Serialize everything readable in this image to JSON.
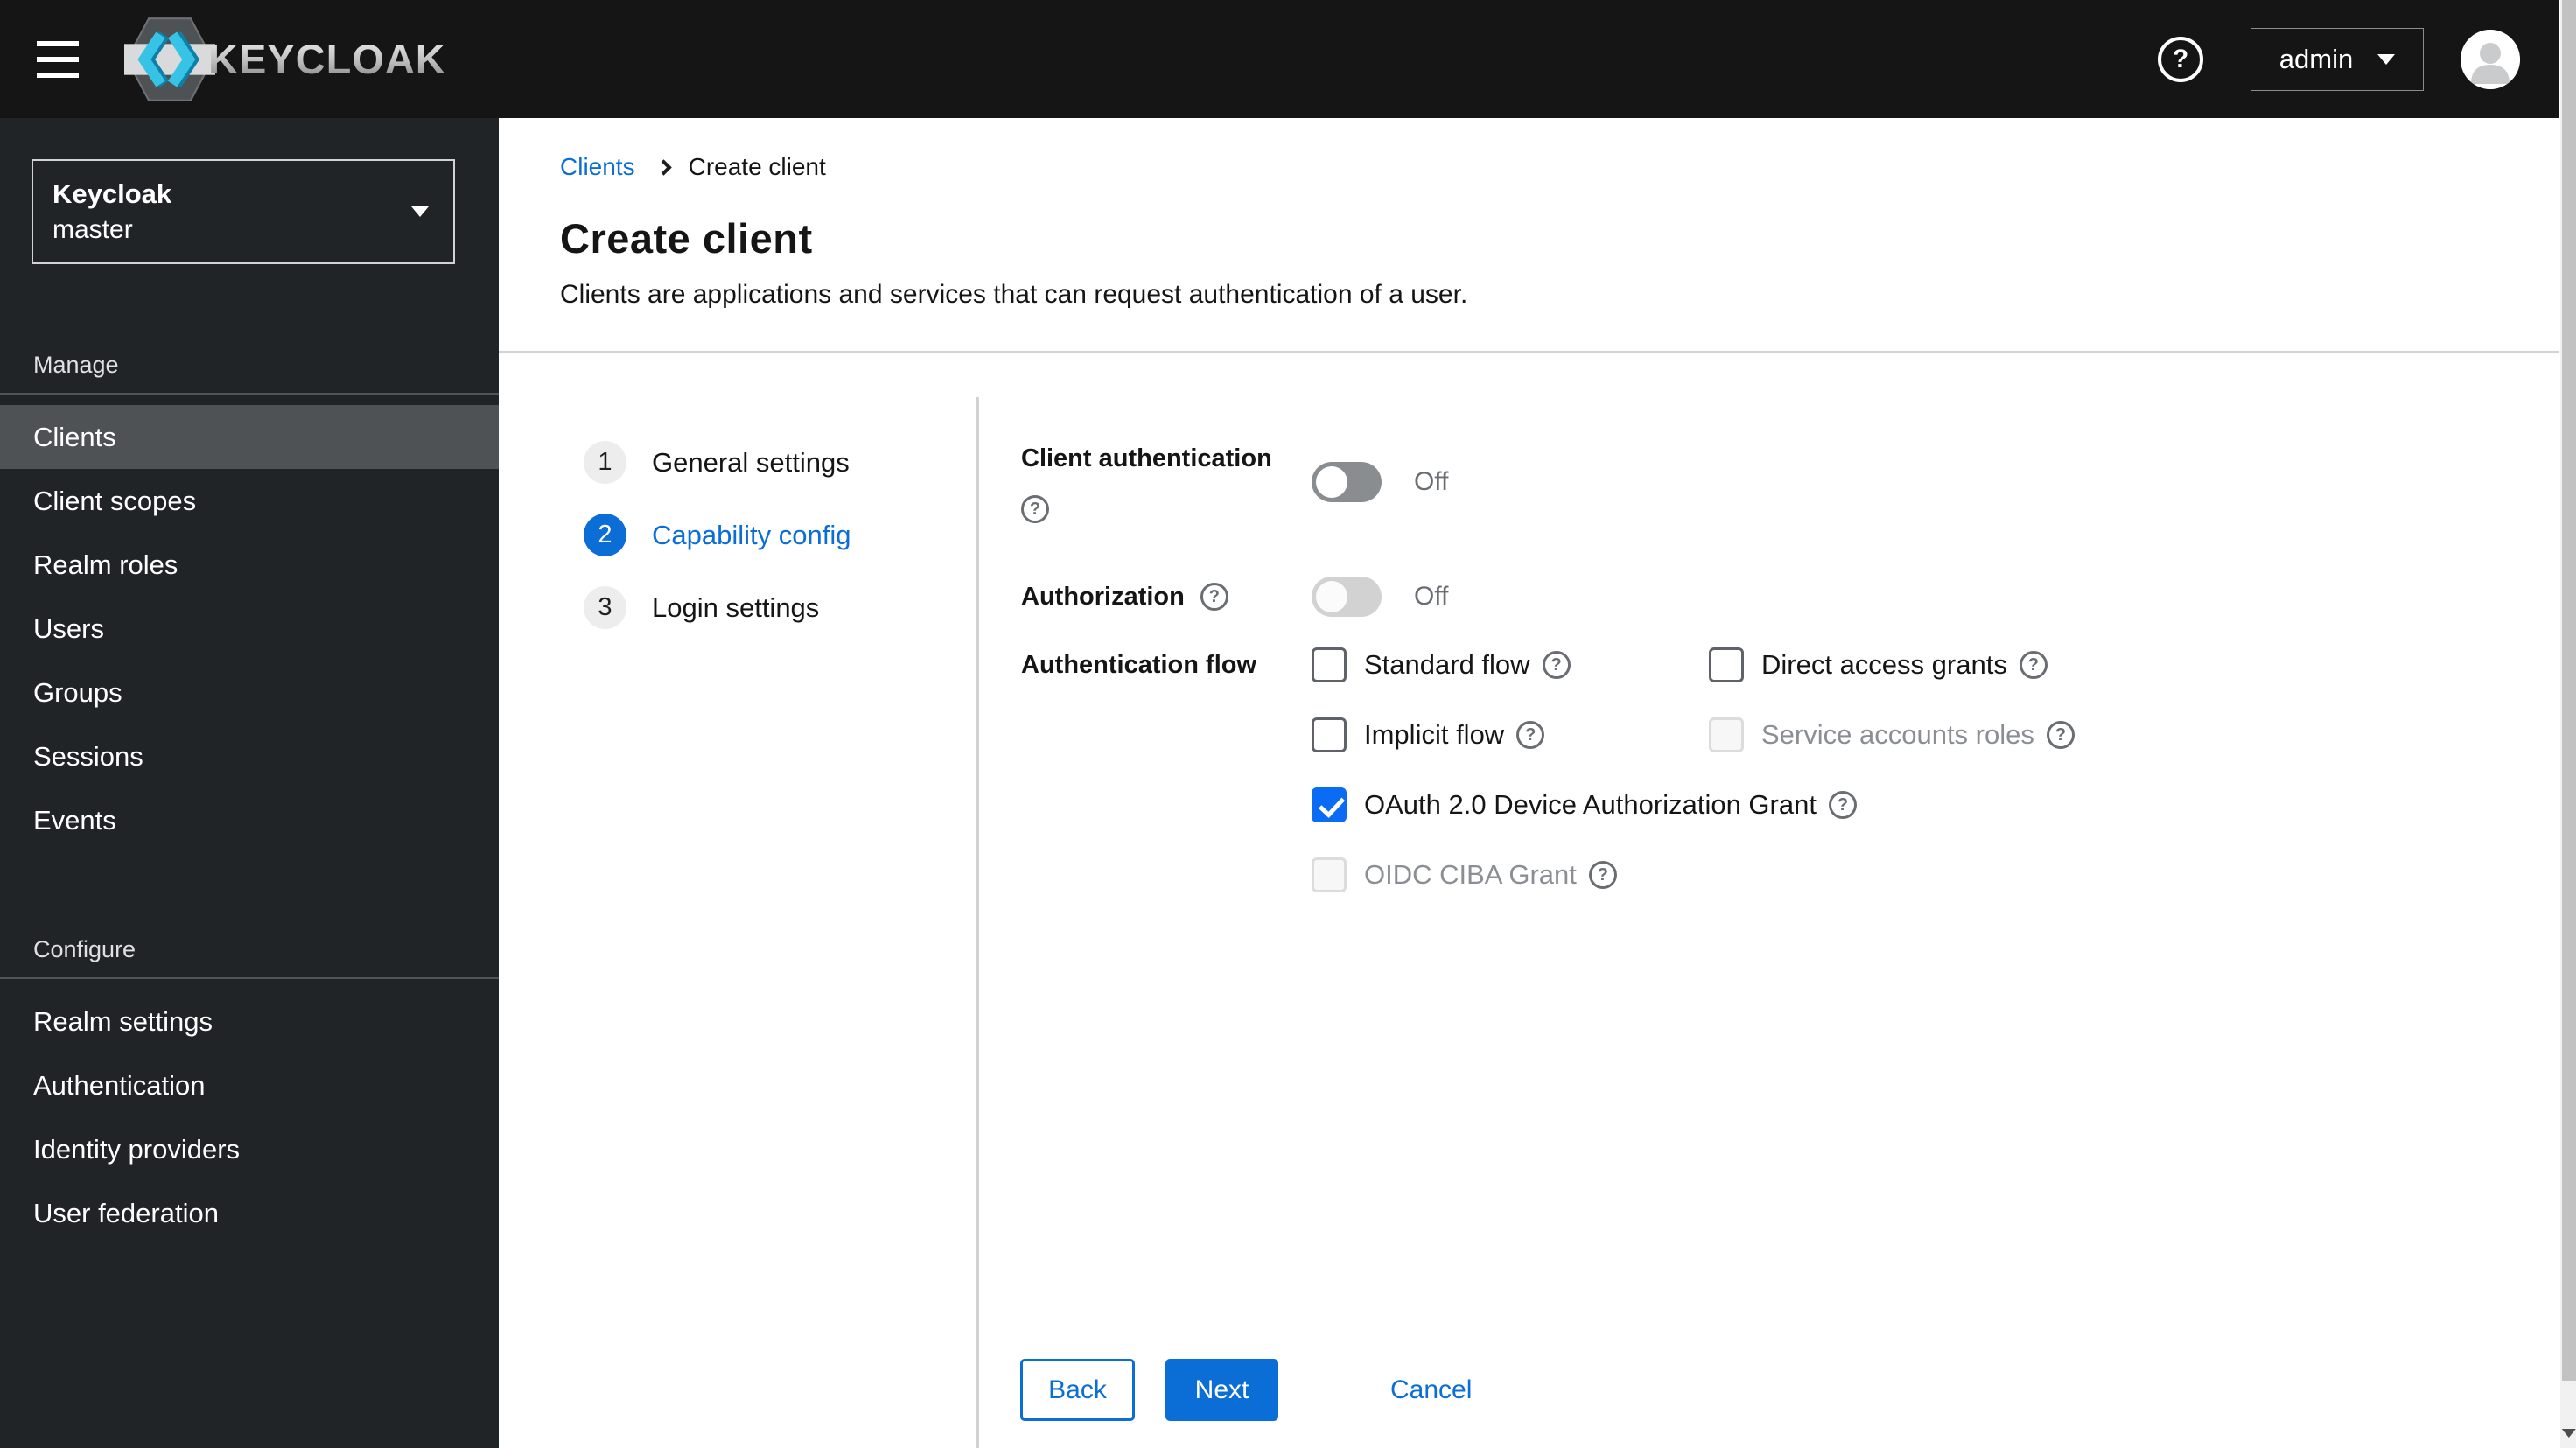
{
  "navbar": {
    "brand": "KEYCLOAK",
    "user": "admin"
  },
  "icons": {
    "question": "?"
  },
  "sidebar": {
    "realm_switcher": {
      "title": "Keycloak",
      "realm": "master"
    },
    "sections": [
      {
        "label": "Manage",
        "items": [
          "Clients",
          "Client scopes",
          "Realm roles",
          "Users",
          "Groups",
          "Sessions",
          "Events"
        ],
        "selected": "Clients"
      },
      {
        "label": "Configure",
        "items": [
          "Realm settings",
          "Authentication",
          "Identity providers",
          "User federation"
        ]
      }
    ]
  },
  "header": {
    "breadcrumb": [
      "Clients",
      "Create client"
    ],
    "title": "Create client",
    "subtitle": "Clients are applications and services that can request authentication of a user."
  },
  "wizard": {
    "steps": [
      {
        "num": "1",
        "label": "General settings",
        "active": false
      },
      {
        "num": "2",
        "label": "Capability config",
        "active": true
      },
      {
        "num": "3",
        "label": "Login settings",
        "active": false
      }
    ]
  },
  "form": {
    "client_auth": {
      "label": "Client authentication",
      "state": "Off",
      "enabled": false
    },
    "authorization": {
      "label": "Authorization",
      "state": "Off",
      "enabled": false,
      "disabled_control": true
    },
    "auth_flow": {
      "label": "Authentication flow",
      "options": [
        {
          "label": "Standard flow",
          "checked": false,
          "disabled": false
        },
        {
          "label": "Direct access grants",
          "checked": false,
          "disabled": false
        },
        {
          "label": "Implicit flow",
          "checked": false,
          "disabled": false
        },
        {
          "label": "Service accounts roles",
          "checked": false,
          "disabled": true
        },
        {
          "label": "OAuth 2.0 Device Authorization Grant",
          "checked": true,
          "disabled": false
        },
        {
          "label": "OIDC CIBA Grant",
          "checked": false,
          "disabled": true
        }
      ]
    }
  },
  "footer": {
    "back": "Back",
    "next": "Next",
    "cancel": "Cancel"
  },
  "colors": {
    "primary_blue": "#0a6ed6",
    "checkbox_blue": "#0a6cf5",
    "masthead_bg": "#151515",
    "sidebar_bg": "#212427",
    "sidebar_selected_bg": "#4f5255",
    "divider": "#d2d2d2",
    "muted_text": "#6a6e73"
  }
}
